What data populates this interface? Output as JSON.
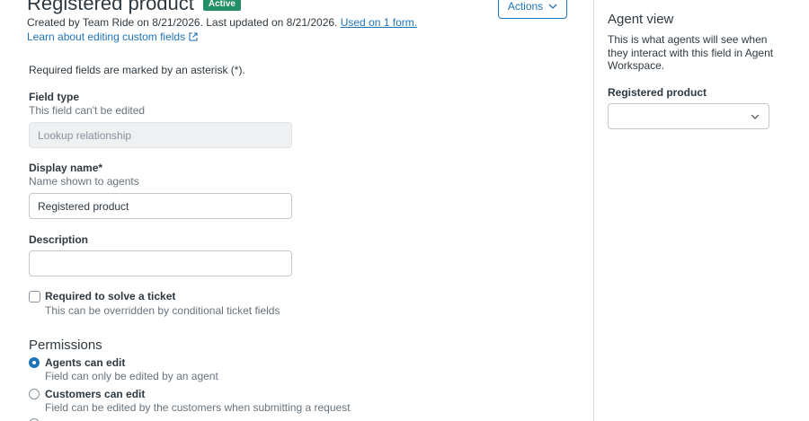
{
  "header": {
    "title": "Registered product",
    "status_badge": "Active",
    "meta_text": "Created by Team Ride on 8/21/2026. Last updated on 8/21/2026.",
    "used_on_link": "Used on 1 form.",
    "learn_link": "Learn about editing custom fields",
    "actions_label": "Actions"
  },
  "form": {
    "required_note": "Required fields are marked by an asterisk (*).",
    "field_type": {
      "label": "Field type",
      "hint": "This field can't be edited",
      "value": "Lookup relationship"
    },
    "display_name": {
      "label": "Display name*",
      "hint": "Name shown to agents",
      "value": "Registered product"
    },
    "description": {
      "label": "Description",
      "value": ""
    },
    "required_checkbox": {
      "label": "Required to solve a ticket",
      "hint": "This can be overridden by conditional ticket fields",
      "checked": false
    },
    "permissions": {
      "title": "Permissions",
      "options": [
        {
          "label": "Agents can edit",
          "hint": "Field can only be edited by an agent",
          "checked": true
        },
        {
          "label": "Customers can edit",
          "hint": "Field can be edited by the customers when submitting a request",
          "checked": false
        }
      ]
    }
  },
  "agent_view": {
    "title": "Agent view",
    "description": "This is what agents will see when they interact with this field in Agent Workspace.",
    "field_label": "Registered product",
    "select_value": ""
  },
  "colors": {
    "accent": "#1f73b7",
    "badge": "#228f67",
    "text": "#2f3941",
    "hint": "#68737d"
  }
}
